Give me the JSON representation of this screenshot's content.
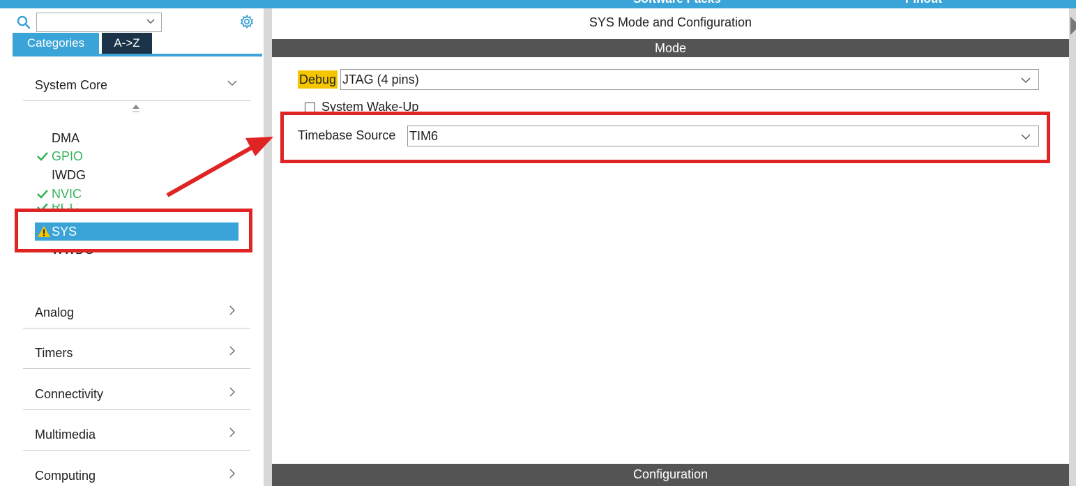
{
  "topbar": {
    "left_text": "Software Packs",
    "right_text": "Pinout"
  },
  "sidebar": {
    "tabs": [
      {
        "label": "Categories",
        "active": true
      },
      {
        "label": "A->Z",
        "active": false
      }
    ],
    "categories": [
      {
        "label": "System Core",
        "expanded": true
      },
      {
        "label": "Analog",
        "expanded": false
      },
      {
        "label": "Timers",
        "expanded": false
      },
      {
        "label": "Connectivity",
        "expanded": false
      },
      {
        "label": "Multimedia",
        "expanded": false
      },
      {
        "label": "Computing",
        "expanded": false
      }
    ],
    "system_core_items": [
      {
        "label": "DMA",
        "status": "none"
      },
      {
        "label": "GPIO",
        "status": "ok"
      },
      {
        "label": "IWDG",
        "status": "none"
      },
      {
        "label": "NVIC",
        "status": "ok"
      },
      {
        "label": "RCC",
        "status": "ok"
      },
      {
        "label": "SYS",
        "status": "warning",
        "selected": true
      },
      {
        "label": "WWDG",
        "status": "none"
      }
    ]
  },
  "main": {
    "title": "SYS Mode and Configuration",
    "mode_header": "Mode",
    "config_header": "Configuration",
    "debug": {
      "label": "Debug",
      "value": "JTAG (4 pins)"
    },
    "wakeup": {
      "label": "System Wake-Up",
      "checked": false
    },
    "timebase": {
      "label": "Timebase Source",
      "value": "TIM6"
    }
  },
  "colors": {
    "accent": "#3aa3d7",
    "dark_tab": "#1b3449",
    "header_bar": "#545454",
    "ok_green": "#34b45c",
    "warning_yellow": "#f5c500",
    "annotation_red": "#e02424"
  },
  "icons": [
    "search-icon",
    "gear-icon",
    "chevron-down-icon",
    "chevron-right-icon",
    "check-icon",
    "warning-icon",
    "sort-icon"
  ]
}
